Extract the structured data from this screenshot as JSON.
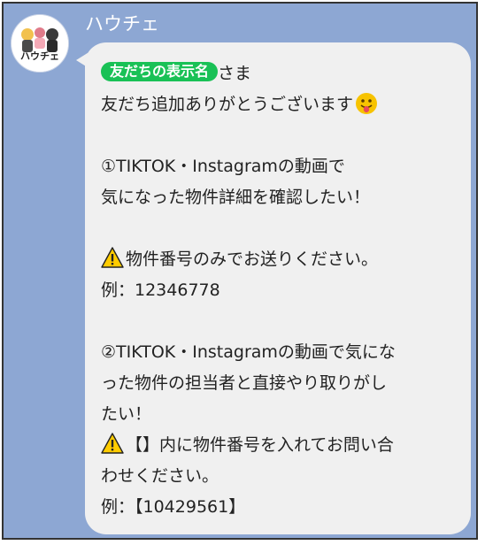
{
  "header": {
    "sender_name": "ハウチェ",
    "avatar_logo_text": "ハウチェ"
  },
  "message": {
    "name_tag": "友だちの表示名",
    "greeting_suffix": "さま",
    "thanks": "友だち追加ありがとうございます",
    "emoji_icon": "tongue-face-icon",
    "warning_icon": "warning-icon",
    "section1_line1": "①TIKTOK・Instagramの動画で",
    "section1_line2": "気になった物件詳細を確認したい！",
    "section1_note": "物件番号のみでお送りください。",
    "section1_example": "例：12346778",
    "section2_line1": "②TIKTOK・Instagramの動画で気にな",
    "section2_line2": "った物件の担当者と直接やり取りがし",
    "section2_line3": "たい！",
    "section2_note_line1": "【】内に物件番号を入れてお問い合",
    "section2_note_line2": "わせください。",
    "section2_example": "例：【10429561】"
  },
  "colors": {
    "chat_background": "#8da7d3",
    "bubble": "#f0f0f0",
    "tag": "#19c156",
    "text": "#222222"
  }
}
